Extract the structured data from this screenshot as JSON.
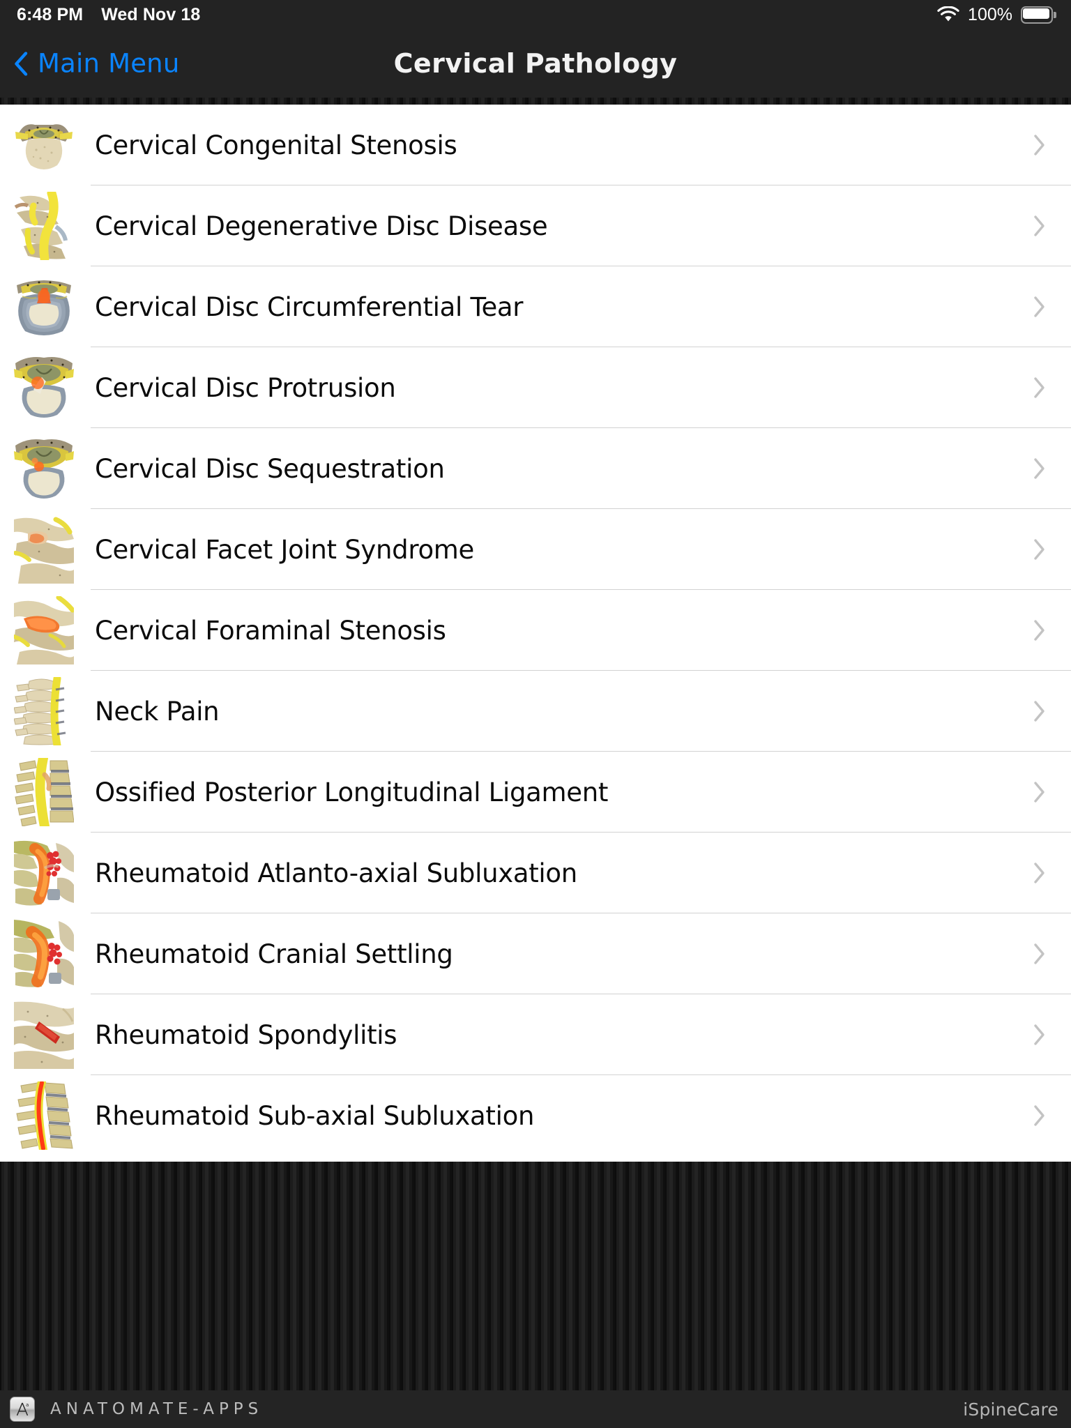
{
  "status_bar": {
    "time": "6:48 PM",
    "date": "Wed Nov 18",
    "battery_percent": "100%",
    "wifi_icon": "wifi-icon",
    "battery_icon": "battery-full-icon"
  },
  "nav_bar": {
    "back_label": "Main Menu",
    "back_icon": "chevron-left-icon",
    "title": "Cervical Pathology"
  },
  "list": {
    "disclosure_icon": "chevron-right-icon",
    "items": [
      {
        "label": "Cervical Congenital Stenosis",
        "thumb": "axial-vertebra-canal-thumb"
      },
      {
        "label": "Cervical Degenerative Disc Disease",
        "thumb": "sagittal-vertebrae-nerve-thumb"
      },
      {
        "label": "Cervical Disc Circumferential Tear",
        "thumb": "axial-disc-annular-tear-thumb"
      },
      {
        "label": "Cervical Disc Protrusion",
        "thumb": "axial-disc-protrusion-thumb"
      },
      {
        "label": "Cervical Disc Sequestration",
        "thumb": "axial-disc-sequestration-thumb"
      },
      {
        "label": "Cervical Facet Joint Syndrome",
        "thumb": "facet-joint-inflammation-thumb"
      },
      {
        "label": "Cervical Foraminal Stenosis",
        "thumb": "foraminal-stenosis-thumb"
      },
      {
        "label": "Neck Pain",
        "thumb": "lateral-cervical-spine-thumb"
      },
      {
        "label": "Ossified Posterior Longitudinal Ligament",
        "thumb": "opll-lateral-spine-thumb"
      },
      {
        "label": "Rheumatoid Atlanto-axial Subluxation",
        "thumb": "atlantoaxial-pannus-thumb"
      },
      {
        "label": "Rheumatoid Cranial Settling",
        "thumb": "cranial-settling-pannus-thumb"
      },
      {
        "label": "Rheumatoid Spondylitis",
        "thumb": "rheumatoid-spondylitis-thumb"
      },
      {
        "label": "Rheumatoid Sub-axial Subluxation",
        "thumb": "subaxial-subluxation-thumb"
      }
    ]
  },
  "footer": {
    "brand": "ANATOMATE-APPS",
    "brand_icon": "anatomate-app-icon",
    "app_name": "iSpineCare"
  },
  "colors": {
    "accent_blue": "#0a84ff",
    "chrome_dark": "#232323",
    "list_background": "#ffffff",
    "separator": "#d2d2d2",
    "chevron_gray": "#c3c3c3",
    "footer_text": "#bdbdbd"
  }
}
